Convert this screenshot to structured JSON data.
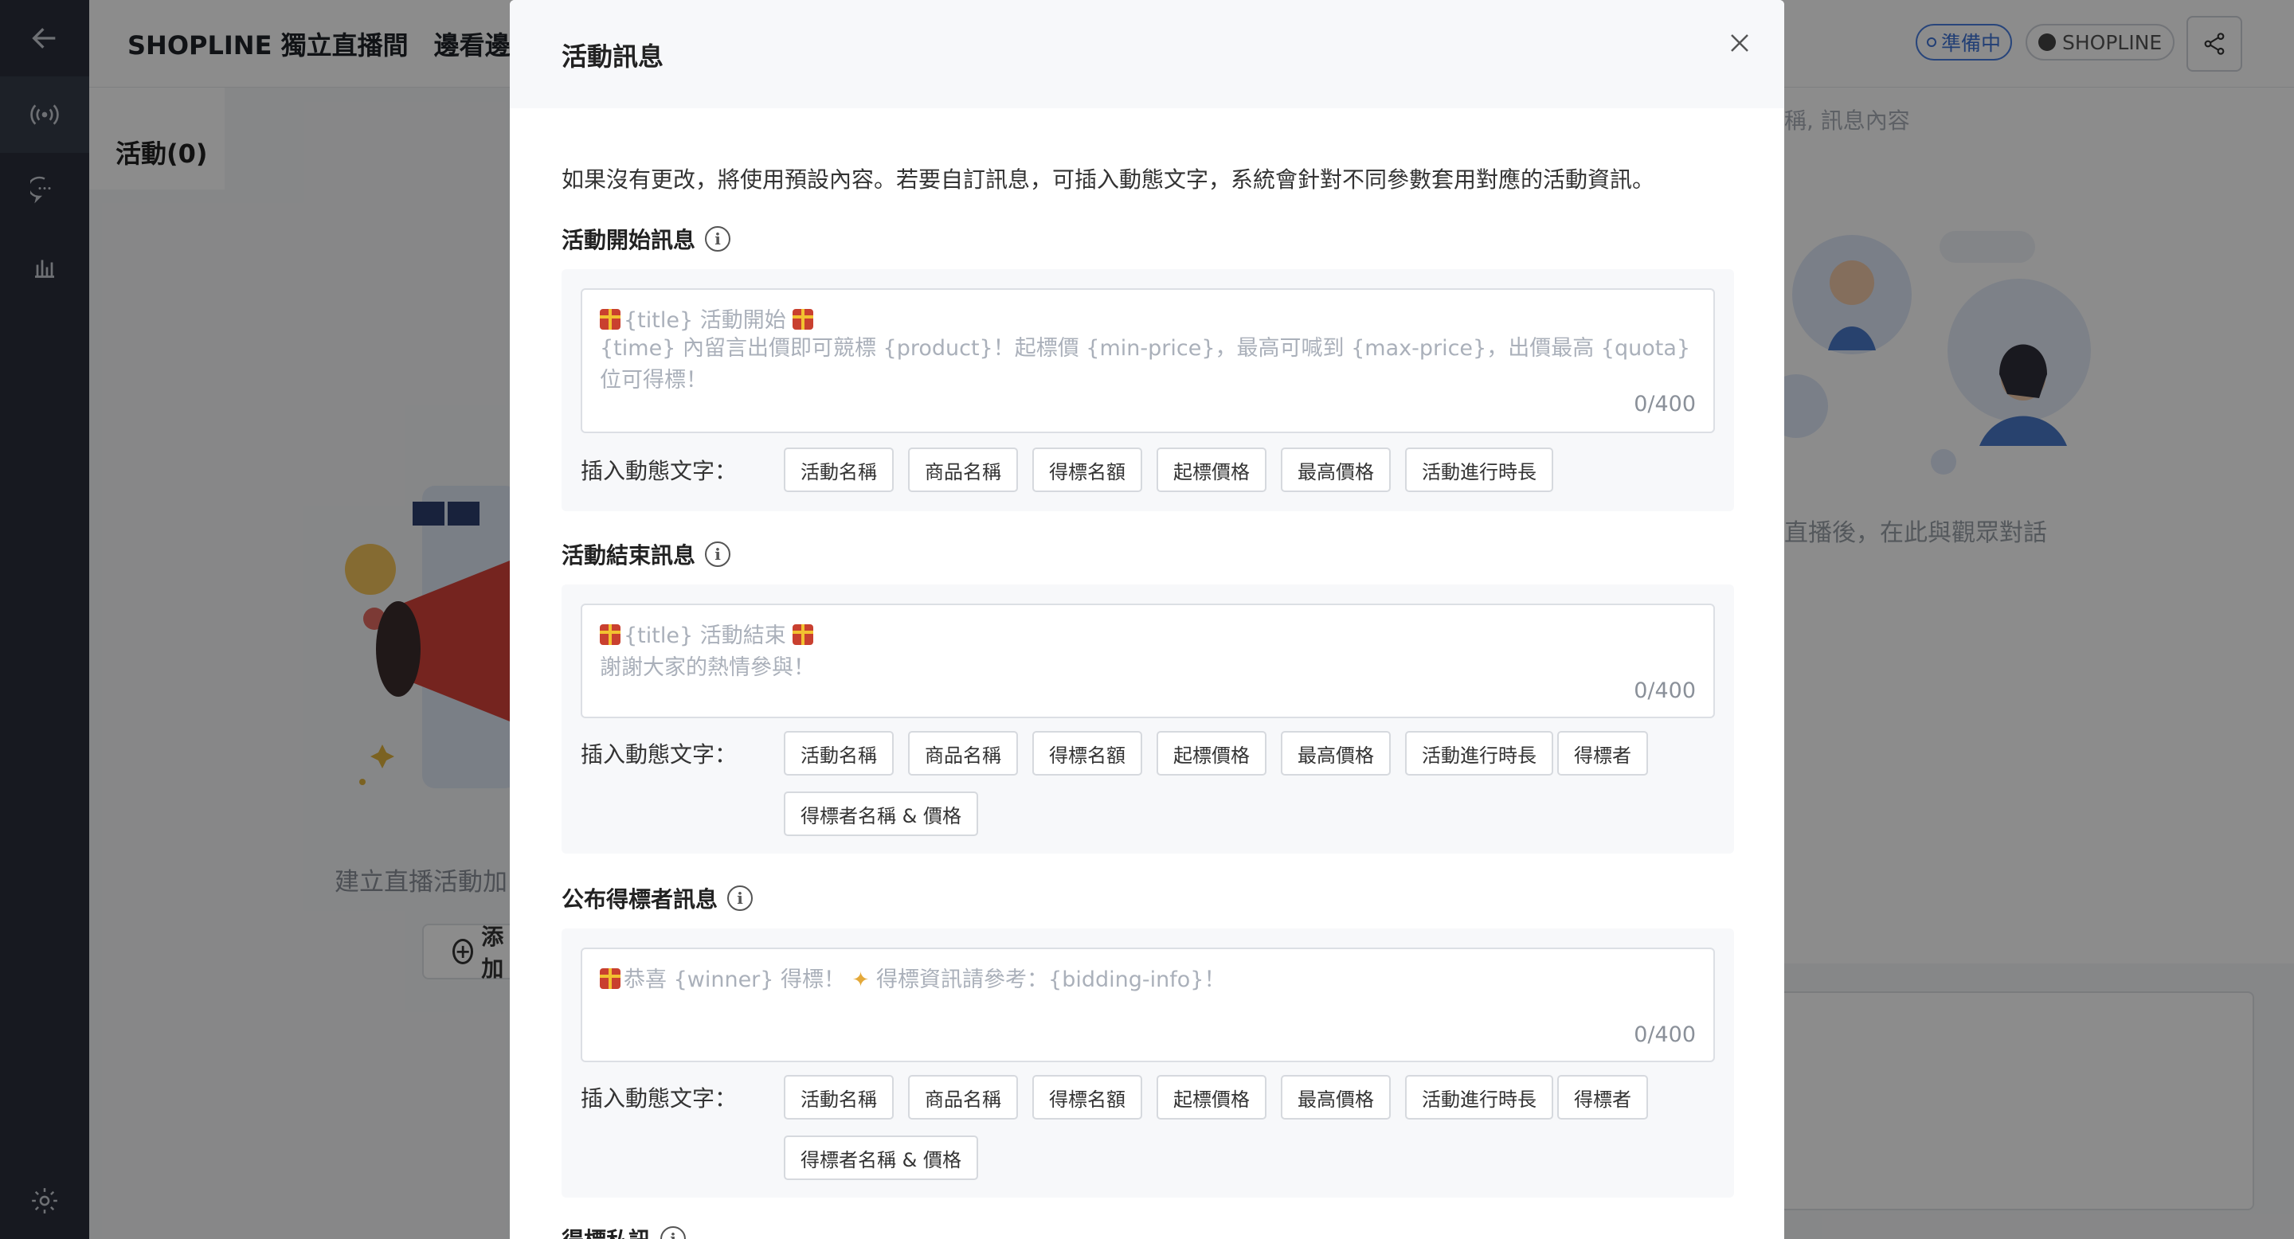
{
  "app": {
    "page_title": "SHOPLINE 獨立直播間　邊看邊買",
    "status_badge": "準備中",
    "brand_badge": "SHOPLINE",
    "activities_title": "活動(0)",
    "empty_text": "建立直播活動加",
    "add_button": "添加",
    "chat_hint_top": "稱, 訊息內容",
    "chat_empty": "直播後，在此與觀眾對話"
  },
  "icons": {
    "back": "arrow-left-icon",
    "live": "broadcast-icon",
    "chat": "chat-bubble-icon",
    "stats": "bar-chart-icon",
    "settings": "gear-icon",
    "share": "share-icon",
    "close": "close-icon",
    "info": "info-icon"
  },
  "modal": {
    "title": "活動訊息",
    "intro": "如果沒有更改，將使用預設內容。若要自訂訊息，可插入動態文字，系統會針對不同參數套用對應的活動資訊。",
    "insert_label": "插入動態文字：",
    "sections": [
      {
        "title": "活動開始訊息",
        "placeholder_line1": "{title} 活動開始",
        "placeholder_line2": "{time} 內留言出價即可競標 {product}！起標價 {min-price}，最高可喊到 {max-price}，出價最高 {quota} 位可得標！",
        "counter": "0/400",
        "chips": [
          "活動名稱",
          "商品名稱",
          "得標名額",
          "起標價格",
          "最高價格",
          "活動進行時長"
        ]
      },
      {
        "title": "活動結束訊息",
        "placeholder_line1": "{title} 活動結束",
        "placeholder_line2": "謝謝大家的熱情參與！",
        "counter": "0/400",
        "chips": [
          "活動名稱",
          "商品名稱",
          "得標名額",
          "起標價格",
          "最高價格",
          "活動進行時長",
          "得標者",
          "得標者名稱 & 價格"
        ]
      },
      {
        "title": "公布得標者訊息",
        "placeholder_a": "恭喜 {winner} 得標！",
        "placeholder_b": "得標資訊請參考：{bidding-info}！",
        "counter": "0/400",
        "chips": [
          "活動名稱",
          "商品名稱",
          "得標名額",
          "起標價格",
          "最高價格",
          "活動進行時長",
          "得標者",
          "得標者名稱 & 價格"
        ]
      },
      {
        "title": "得標私訊"
      }
    ]
  }
}
